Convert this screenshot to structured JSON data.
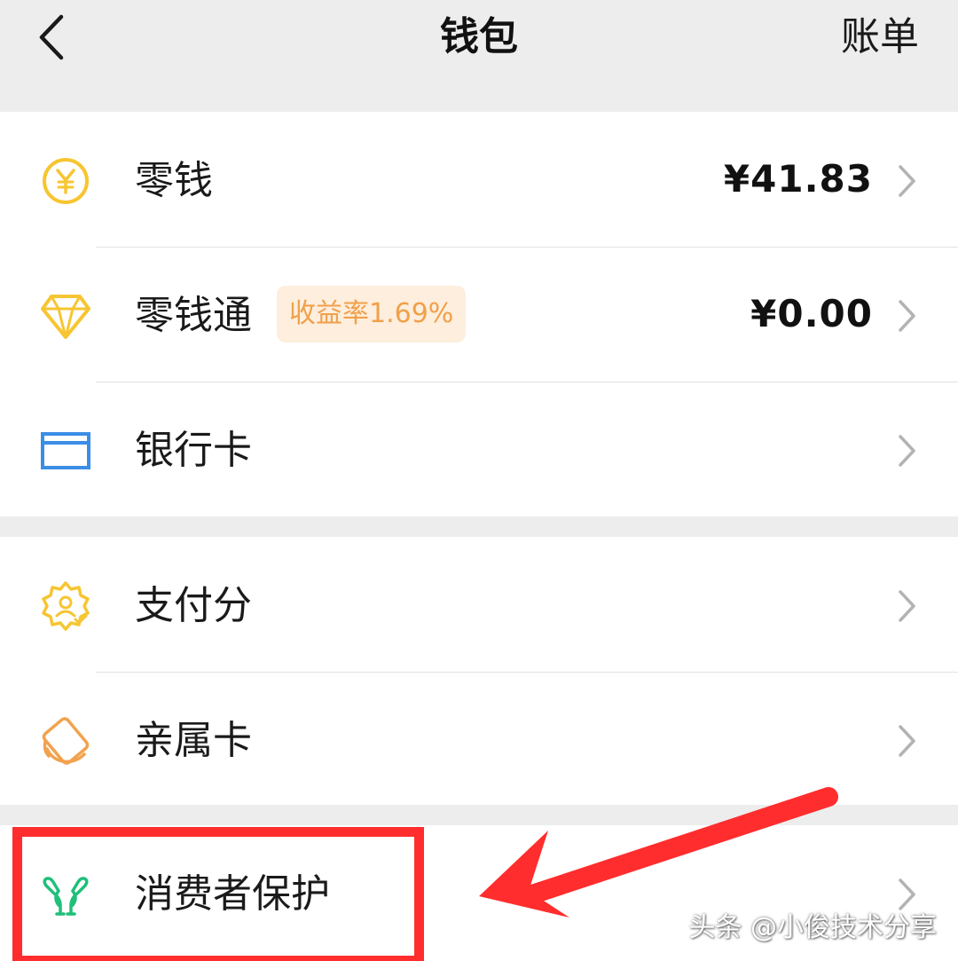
{
  "header": {
    "title": "钱包",
    "bill_label": "账单",
    "back_icon": "chevron-left-icon"
  },
  "groups": [
    {
      "rows": [
        {
          "icon": "yuan-coin-icon",
          "label": "零钱",
          "value": "¥41.83"
        },
        {
          "icon": "diamond-icon",
          "label": "零钱通",
          "badge": "收益率1.69%",
          "value": "¥0.00"
        },
        {
          "icon": "bank-card-icon",
          "label": "银行卡",
          "value": ""
        }
      ]
    },
    {
      "rows": [
        {
          "icon": "credit-score-badge-icon",
          "label": "支付分",
          "value": ""
        },
        {
          "icon": "family-card-icon",
          "label": "亲属卡",
          "value": ""
        }
      ]
    },
    {
      "rows": [
        {
          "icon": "protect-hands-icon",
          "label": "消费者保护",
          "value": ""
        }
      ]
    }
  ],
  "watermark": "头条 @小俊技术分享",
  "colors": {
    "background": "#ededed",
    "card": "#ffffff",
    "coin_yellow": "#f7c531",
    "bank_blue": "#3a8ee6",
    "family_orange": "#f2a24e",
    "protect_green": "#1fbf7a",
    "badge_bg": "#fdeedd",
    "badge_text": "#f0a04a",
    "annotation_red": "#ff2d2d"
  }
}
